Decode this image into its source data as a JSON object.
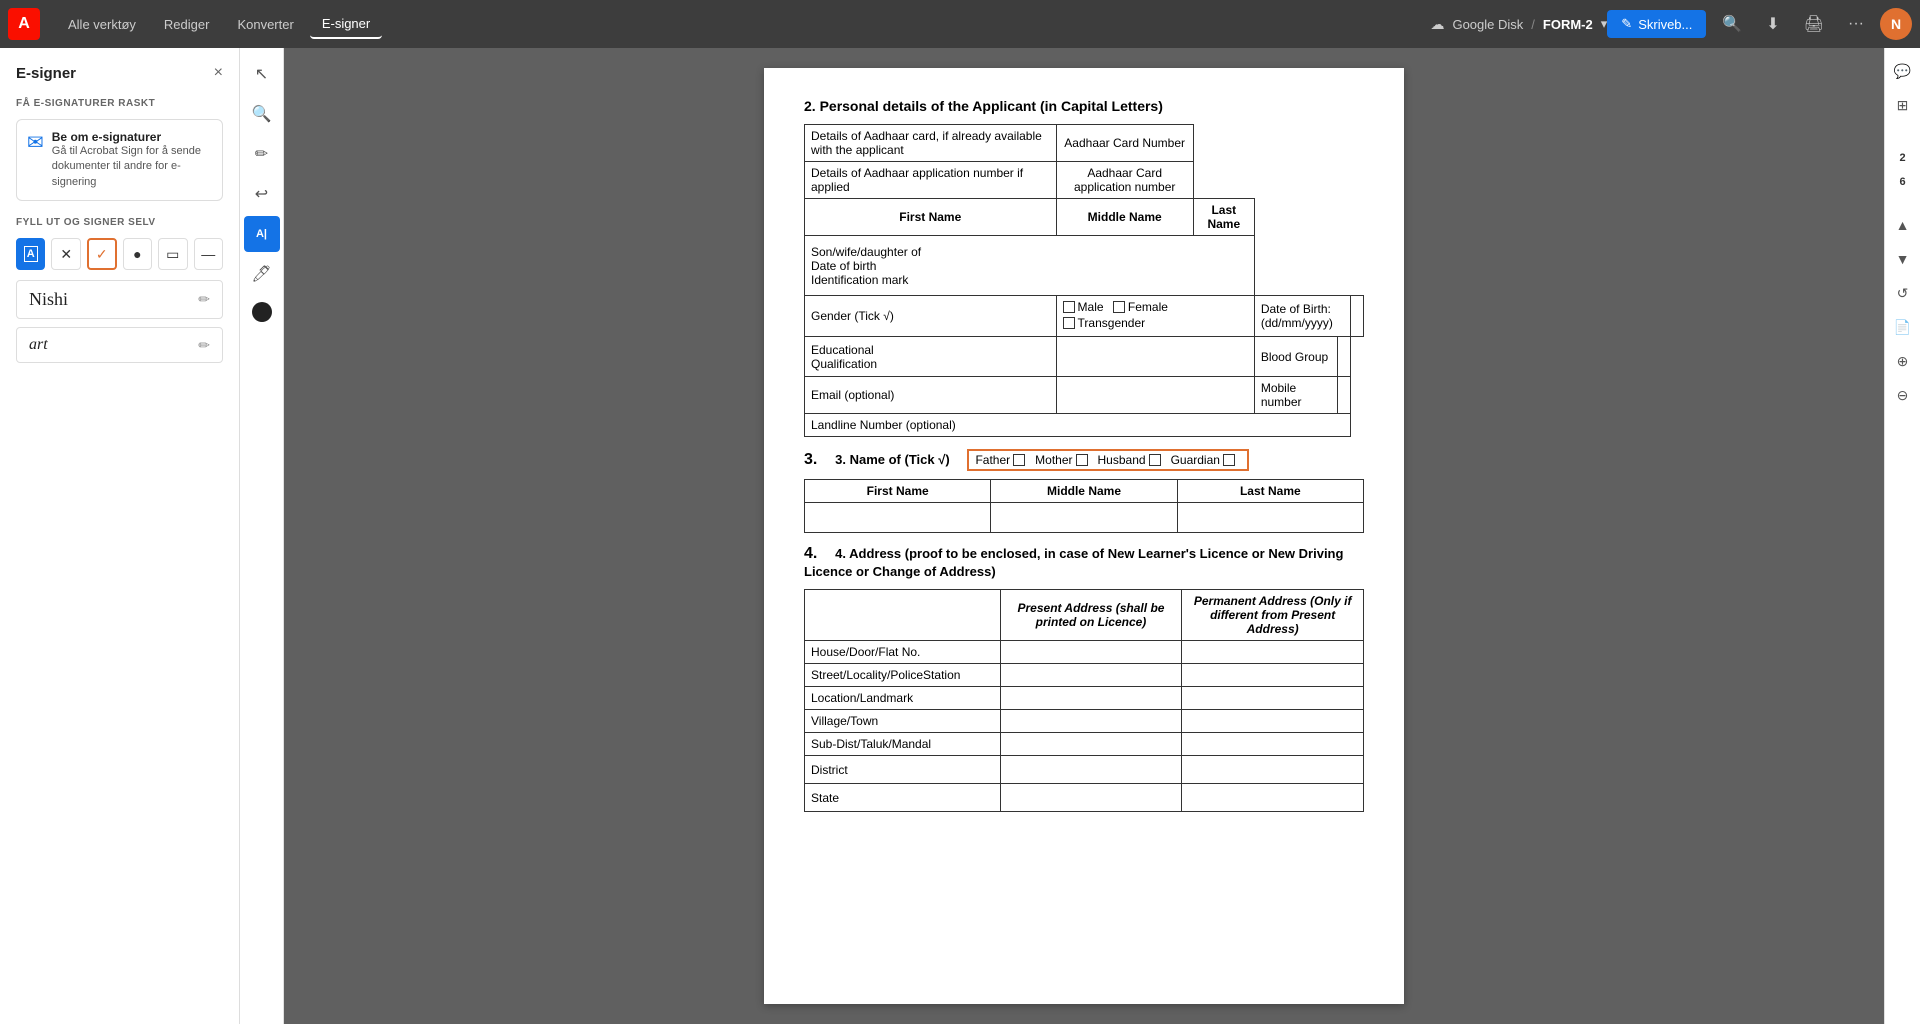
{
  "topbar": {
    "logo_text": "A",
    "nav_items": [
      "Alle verktøy",
      "Rediger",
      "Konverter",
      "E-signer"
    ],
    "active_nav": "E-signer",
    "cloud_label": "Google Disk",
    "separator": "/",
    "filename": "FORM-2",
    "write_btn": "Skriveb...",
    "write_icon": "✎"
  },
  "esigner": {
    "title": "E-signer",
    "close": "×",
    "fast_section": "FÅ E-SIGNATURER RASKT",
    "promo_title": "Be om e-signaturer",
    "promo_desc": "Gå til Acrobat Sign for å sende dokumenter til andre for e-signering",
    "fill_section": "FYLL UT OG SIGNER SELV",
    "signature1": "Nishi",
    "signature2": "art"
  },
  "document": {
    "section2_title": "2.   Personal details of the Applicant (in Capital Letters)",
    "aadhaar_label": "Details of Aadhaar card, if already available with the applicant",
    "aadhaar_number_label": "Aadhaar Card Number",
    "aadhaar_app_label": "Details of Aadhaar application number if applied",
    "aadhaar_app_number_label": "Aadhaar Card application number",
    "first_name": "First Name",
    "middle_name": "Middle Name",
    "last_name": "Last Name",
    "son_wife_label": "Son/wife/daughter of\nDate of birth\nIdentification mark",
    "gender_label": "Gender (Tick √)",
    "male_label": "Male",
    "female_label": "Female",
    "transgender_label": "Transgender",
    "dob_label": "Date of Birth:\n(dd/mm/yyyy)",
    "edu_qual_label": "Educational\nQualification",
    "blood_group_label": "Blood Group",
    "email_label": "Email (optional)",
    "mobile_label": "Mobile number",
    "landline_label": "Landline Number (optional)",
    "section3_title": "3.   Name of (Tick √)",
    "father_label": "Father",
    "mother_label": "Mother",
    "husband_label": "Husband",
    "guardian_label": "Guardian",
    "section4_title": "4.   Address (proof to be enclosed, in case of New Learner's Licence or New Driving Licence or Change of Address)",
    "present_address": "Present Address (shall be printed on Licence)",
    "permanent_address": "Permanent Address (Only if different from Present Address)",
    "house_label": "House/Door/Flat No.",
    "street_label": "Street/Locality/PoliceStation",
    "location_label": "Location/Landmark",
    "village_label": "Village/Town",
    "sub_dist_label": "Sub-Dist/Taluk/Mandal",
    "district_label": "District",
    "state_label": "State"
  },
  "right_sidebar": {
    "page_nums": [
      "2",
      "6"
    ],
    "icons": [
      "↑",
      "↓",
      "↺",
      "📄",
      "🔍+",
      "🔍-"
    ]
  }
}
